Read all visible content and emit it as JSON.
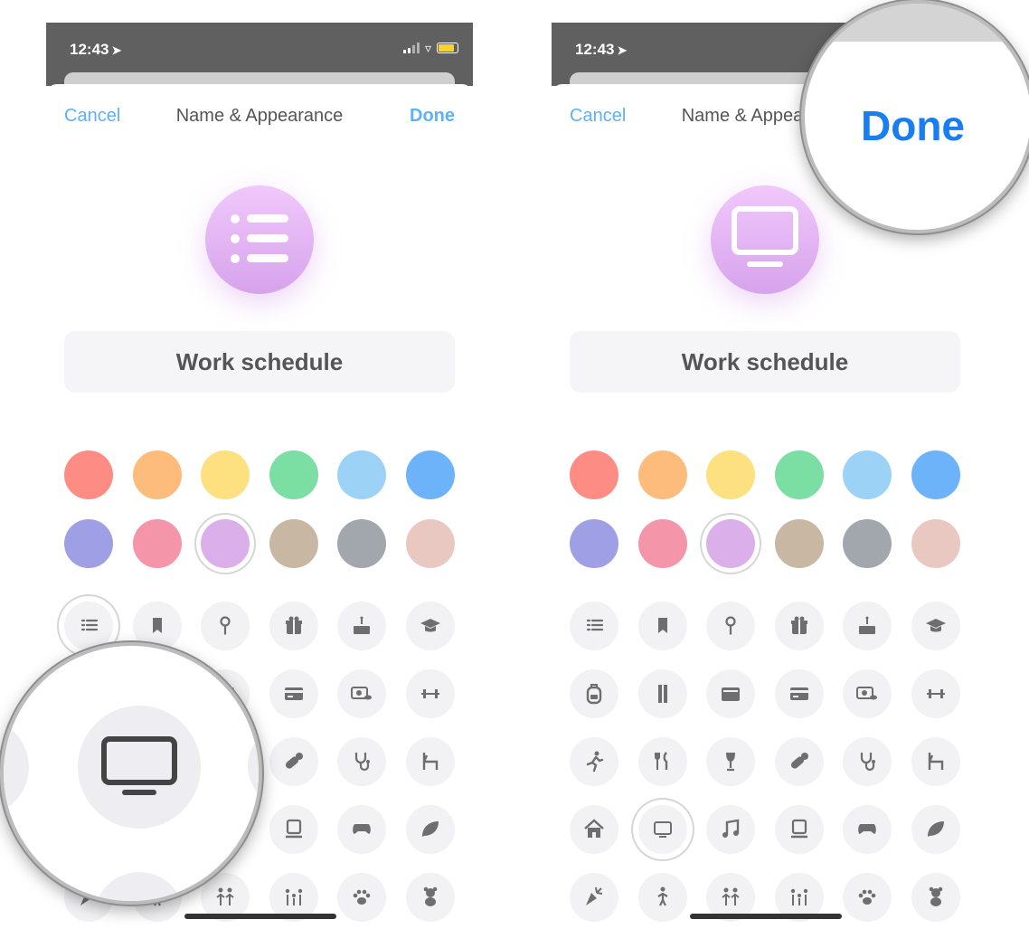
{
  "status_bar": {
    "time": "12:43",
    "location_glyph": "➤"
  },
  "nav": {
    "cancel_label": "Cancel",
    "title": "Name & Appearance",
    "done_label": "Done"
  },
  "list_name": "Work schedule",
  "colors": [
    "#fd8d84",
    "#fdbb7c",
    "#fde07f",
    "#7bdfa3",
    "#9dd2f7",
    "#6cb3fa",
    "#9f9fe6",
    "#f495aa",
    "#dbb0ea",
    "#c8b7a3",
    "#a2a7ae",
    "#eac8c2"
  ],
  "selected_color_index": 8,
  "icons": [
    "list-icon",
    "bookmark-icon",
    "pin-icon",
    "gift-icon",
    "cake-icon",
    "graduation-cap-icon",
    "backpack-icon",
    "ruler-pencil-icon",
    "wallet-icon",
    "credit-card-icon",
    "money-icon",
    "dumbbell-icon",
    "runner-icon",
    "fork-knife-icon",
    "wine-glass-icon",
    "pill-icon",
    "stethoscope-icon",
    "chair-icon",
    "house-icon",
    "tv-icon",
    "music-note-icon",
    "computer-icon",
    "gamepad-icon",
    "leaf-icon",
    "carrot-icon",
    "person-icon",
    "two-people-icon",
    "family-icon",
    "paw-icon",
    "teddy-bear-icon"
  ],
  "left_selected_icon": "list-icon",
  "right_selected_icon": "tv-icon",
  "magnifier_done_label": "Done"
}
